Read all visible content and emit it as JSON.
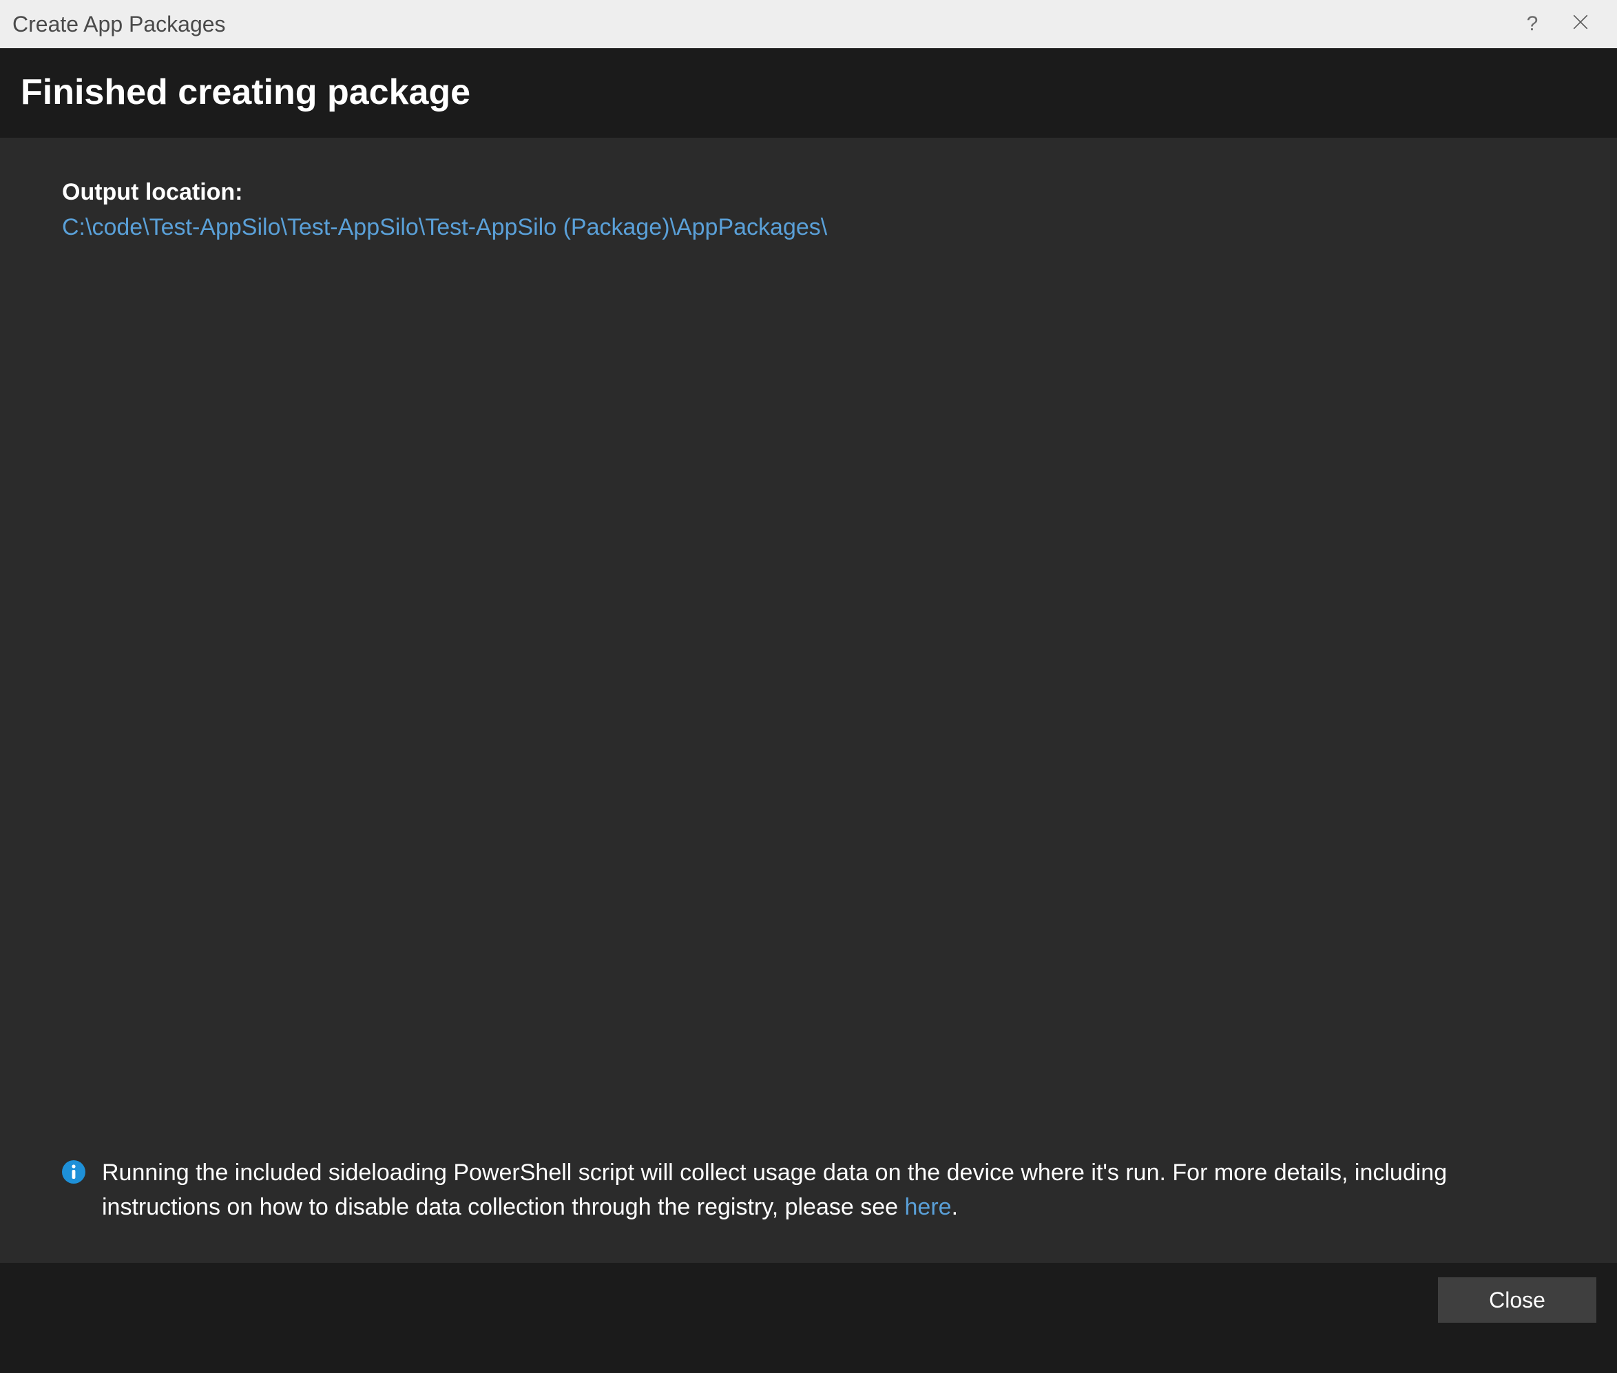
{
  "window": {
    "title": "Create App Packages"
  },
  "header": {
    "title": "Finished creating package"
  },
  "output": {
    "label": "Output location:",
    "path": "C:\\code\\Test-AppSilo\\Test-AppSilo\\Test-AppSilo (Package)\\AppPackages\\"
  },
  "info": {
    "text_before_link": "Running the included sideloading PowerShell script will collect usage data on the device where it's run.  For more details, including instructions on how to disable data collection through the registry, please see  ",
    "link_text": "here",
    "text_after_link": "."
  },
  "footer": {
    "close_label": "Close"
  },
  "icons": {
    "help": "?",
    "close": "close-icon",
    "info": "info-icon"
  },
  "colors": {
    "titlebar_bg": "#eeeeee",
    "header_bg": "#1b1b1b",
    "content_bg": "#2b2b2b",
    "link": "#5aa0d8",
    "button_bg": "#3f3f3f",
    "info_icon": "#1e90d8"
  }
}
